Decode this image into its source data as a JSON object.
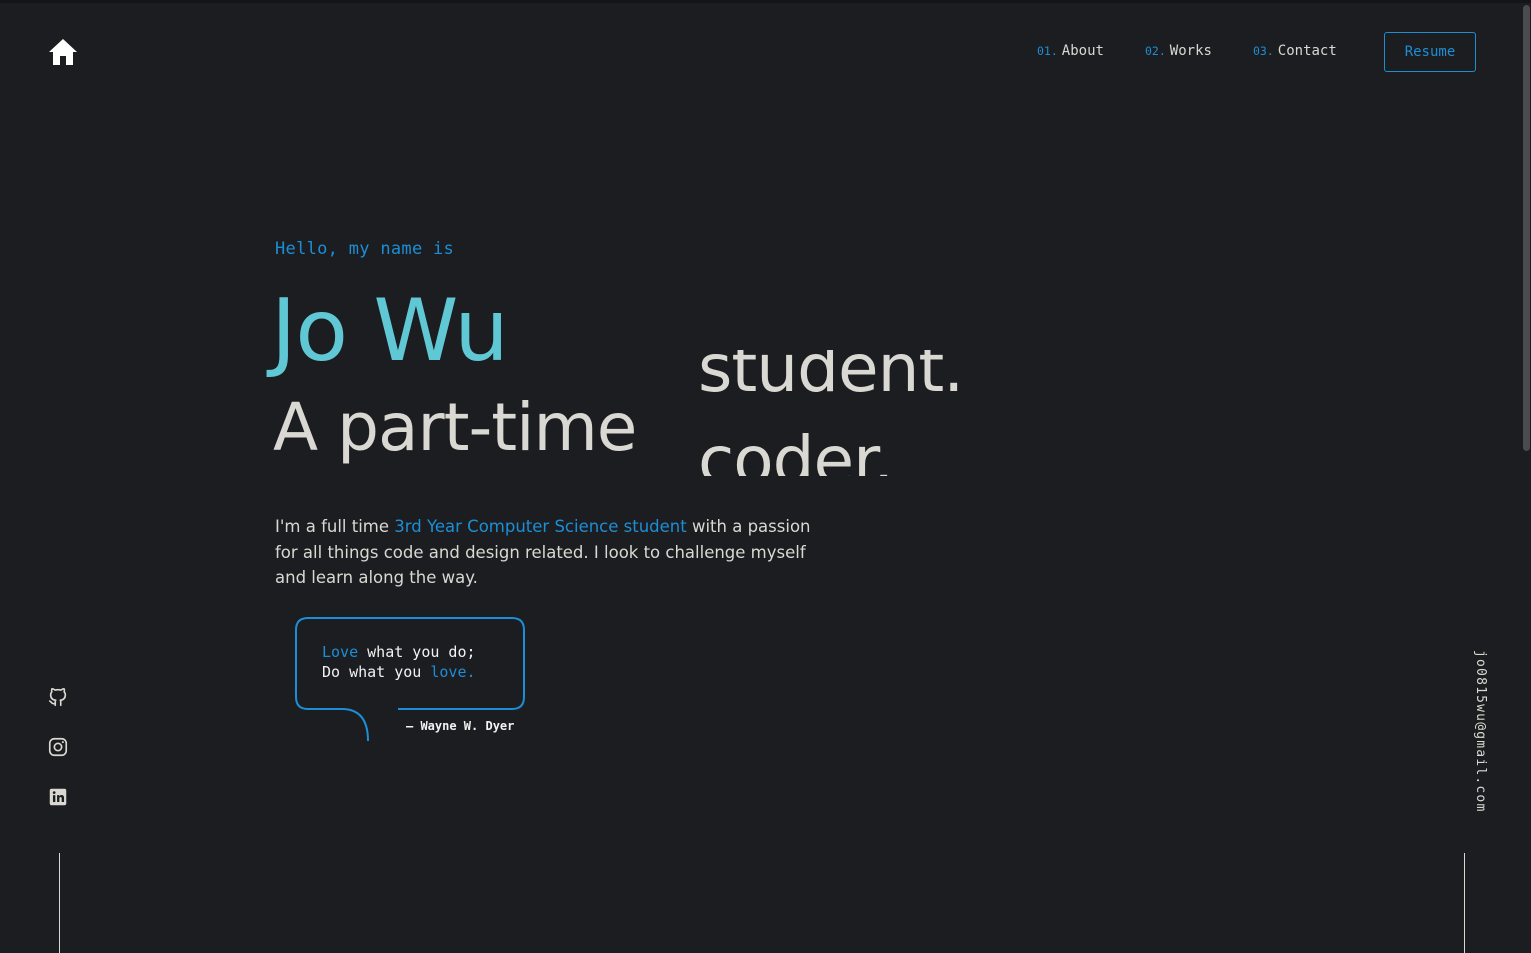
{
  "header": {
    "home_icon": "home-icon",
    "nav": [
      {
        "num": "01.",
        "label": "About"
      },
      {
        "num": "02.",
        "label": "Works"
      },
      {
        "num": "03.",
        "label": "Contact"
      }
    ],
    "resume_label": "Resume"
  },
  "hero": {
    "greeting": "Hello, my name is",
    "name": "Jo Wu",
    "tagline_prefix": "A part-time",
    "rotating_prev": "student.",
    "rotating_current": "coder.",
    "description": {
      "part1": "I'm a full time ",
      "highlight": "3rd Year Computer Science student",
      "part2": " with a passion for all things code and design related. I look to challenge myself and learn along the way."
    },
    "quote": {
      "line1_hl": "Love",
      "line1_rest": " what you do;",
      "line2_pre": "Do what you ",
      "line2_hl": "love.",
      "author": "— Wayne W. Dyer"
    }
  },
  "socials": [
    {
      "icon": "github-icon"
    },
    {
      "icon": "instagram-icon"
    },
    {
      "icon": "linkedin-icon"
    }
  ],
  "email": "jo0815wu@gmail.com",
  "colors": {
    "background": "#1c1d20",
    "accent": "#1c8ed6",
    "name": "#5fc8d4",
    "text": "#d9d8d2"
  }
}
